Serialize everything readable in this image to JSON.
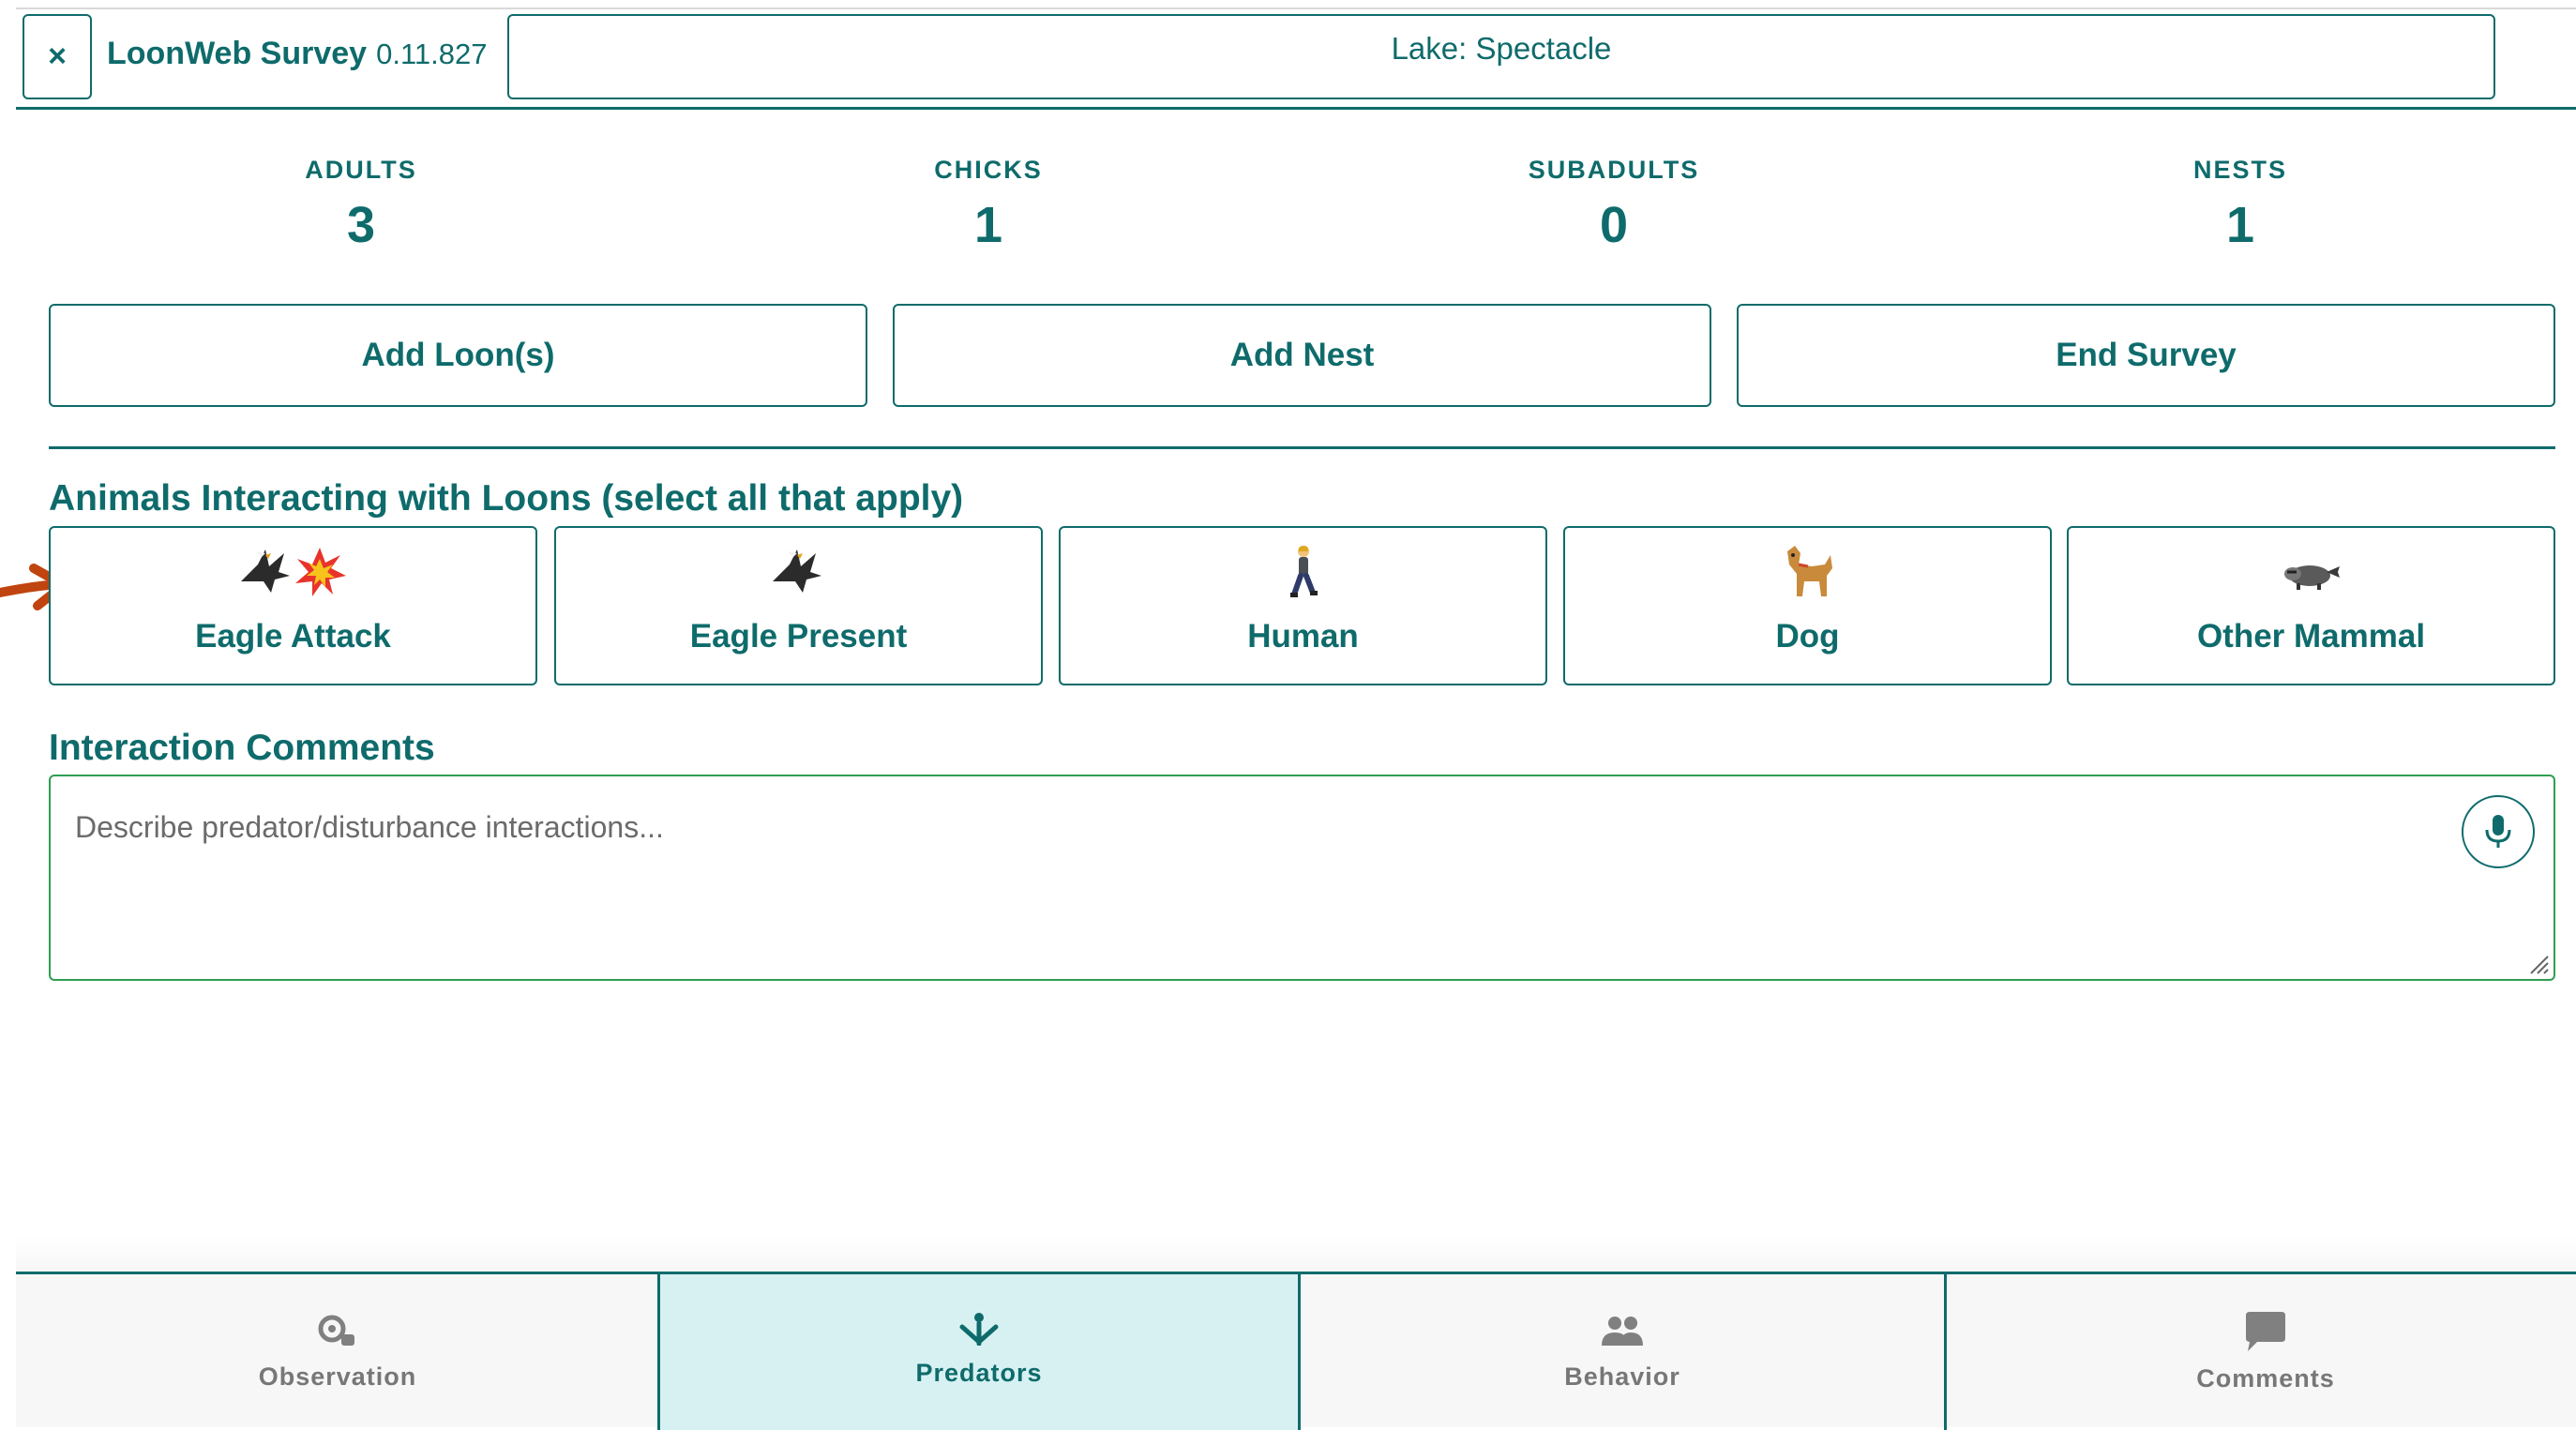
{
  "header": {
    "close_label": "×",
    "app_name": "LoonWeb Survey",
    "version": "0.11.827",
    "lake": "Lake: Spectacle"
  },
  "counts": [
    {
      "label": "ADULTS",
      "value": "3"
    },
    {
      "label": "CHICKS",
      "value": "1"
    },
    {
      "label": "SUBADULTS",
      "value": "0"
    },
    {
      "label": "NESTS",
      "value": "1"
    }
  ],
  "actions": {
    "add_loons": "Add Loon(s)",
    "add_nest": "Add Nest",
    "end_survey": "End Survey"
  },
  "animals": {
    "title": "Animals Interacting with Loons (select all that apply)",
    "items": [
      {
        "label": "Eagle Attack",
        "icon": "eagle-attack-icon"
      },
      {
        "label": "Eagle Present",
        "icon": "eagle-icon"
      },
      {
        "label": "Human",
        "icon": "person-walking-icon"
      },
      {
        "label": "Dog",
        "icon": "dog-icon"
      },
      {
        "label": "Other Mammal",
        "icon": "raccoon-icon"
      }
    ]
  },
  "comments": {
    "title": "Interaction Comments",
    "placeholder": "Describe predator/disturbance interactions...",
    "value": ""
  },
  "tabs": [
    {
      "label": "Observation",
      "icon": "binoculars-icon",
      "active": false
    },
    {
      "label": "Predators",
      "icon": "predator-icon",
      "active": true
    },
    {
      "label": "Behavior",
      "icon": "people-icon",
      "active": false
    },
    {
      "label": "Comments",
      "icon": "comment-icon",
      "active": false
    }
  ],
  "colors": {
    "primary": "#0f6b6b",
    "active_tab_bg": "#d7f1f3",
    "comment_border": "#2e9e52",
    "arrow": "#c0440f"
  }
}
